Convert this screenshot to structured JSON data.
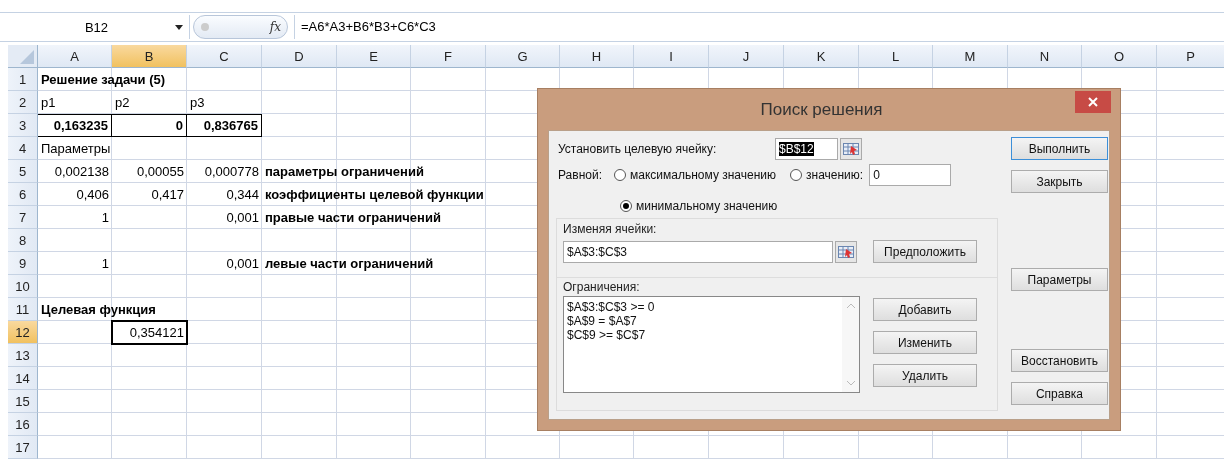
{
  "formula_bar": {
    "name_box": "B12",
    "function_symbol": "fx",
    "formula": "=A6*A3+B6*B3+C6*C3"
  },
  "sheet": {
    "columns": [
      {
        "label": "A",
        "selected": false
      },
      {
        "label": "B",
        "selected": true
      },
      {
        "label": "C",
        "selected": false
      },
      {
        "label": "D",
        "selected": false
      },
      {
        "label": "E",
        "selected": false
      },
      {
        "label": "F",
        "selected": false
      },
      {
        "label": "G",
        "selected": false
      },
      {
        "label": "H",
        "selected": false
      },
      {
        "label": "I",
        "selected": false
      },
      {
        "label": "J",
        "selected": false
      },
      {
        "label": "K",
        "selected": false
      },
      {
        "label": "L",
        "selected": false
      },
      {
        "label": "M",
        "selected": false
      },
      {
        "label": "N",
        "selected": false
      },
      {
        "label": "O",
        "selected": false
      },
      {
        "label": "P",
        "selected": false
      }
    ],
    "rows": [
      {
        "header": "1",
        "selected": false,
        "cells": [
          {
            "text": "Решение задачи (5)",
            "kind": "text",
            "bold": true,
            "bordered": false,
            "selected": false
          }
        ]
      },
      {
        "header": "2",
        "selected": false,
        "cells": [
          {
            "text": "p1",
            "kind": "text",
            "bold": false,
            "bordered": false,
            "selected": false
          },
          {
            "text": "p2",
            "kind": "text",
            "bold": false,
            "bordered": false,
            "selected": false
          },
          {
            "text": "p3",
            "kind": "text",
            "bold": false,
            "bordered": false,
            "selected": false
          }
        ]
      },
      {
        "header": "3",
        "selected": false,
        "cells": [
          {
            "text": "0,163235",
            "kind": "number",
            "bold": true,
            "bordered": true,
            "selected": false
          },
          {
            "text": "0",
            "kind": "number",
            "bold": true,
            "bordered": true,
            "selected": false
          },
          {
            "text": "0,836765",
            "kind": "number",
            "bold": true,
            "bordered": true,
            "selected": false
          }
        ]
      },
      {
        "header": "4",
        "selected": false,
        "cells": [
          {
            "text": "Параметры",
            "kind": "text",
            "bold": false,
            "bordered": false,
            "selected": false
          }
        ]
      },
      {
        "header": "5",
        "selected": false,
        "cells": [
          {
            "text": "0,002138",
            "kind": "number",
            "bold": false,
            "bordered": false,
            "selected": false
          },
          {
            "text": "0,00055",
            "kind": "number",
            "bold": false,
            "bordered": false,
            "selected": false
          },
          {
            "text": "0,000778",
            "kind": "number",
            "bold": false,
            "bordered": false,
            "selected": false
          },
          {
            "text": "параметры ограничений",
            "kind": "text",
            "bold": true,
            "bordered": false,
            "selected": false
          }
        ]
      },
      {
        "header": "6",
        "selected": false,
        "cells": [
          {
            "text": "0,406",
            "kind": "number",
            "bold": false,
            "bordered": false,
            "selected": false
          },
          {
            "text": "0,417",
            "kind": "number",
            "bold": false,
            "bordered": false,
            "selected": false
          },
          {
            "text": "0,344",
            "kind": "number",
            "bold": false,
            "bordered": false,
            "selected": false
          },
          {
            "text": "коэффициенты целевой функции",
            "kind": "text",
            "bold": true,
            "bordered": false,
            "selected": false
          }
        ]
      },
      {
        "header": "7",
        "selected": false,
        "cells": [
          {
            "text": "1",
            "kind": "number",
            "bold": false,
            "bordered": false,
            "selected": false
          },
          null,
          {
            "text": "0,001",
            "kind": "number",
            "bold": false,
            "bordered": false,
            "selected": false
          },
          {
            "text": "правые части ограничений",
            "kind": "text",
            "bold": true,
            "bordered": false,
            "selected": false
          }
        ]
      },
      {
        "header": "8",
        "selected": false,
        "cells": []
      },
      {
        "header": "9",
        "selected": false,
        "cells": [
          {
            "text": "1",
            "kind": "number",
            "bold": false,
            "bordered": false,
            "selected": false
          },
          null,
          {
            "text": "0,001",
            "kind": "number",
            "bold": false,
            "bordered": false,
            "selected": false
          },
          {
            "text": "левые части ограничений",
            "kind": "text",
            "bold": true,
            "bordered": false,
            "selected": false
          }
        ]
      },
      {
        "header": "10",
        "selected": false,
        "cells": []
      },
      {
        "header": "11",
        "selected": false,
        "cells": [
          {
            "text": "Целевая функция",
            "kind": "text",
            "bold": true,
            "bordered": false,
            "selected": false
          }
        ]
      },
      {
        "header": "12",
        "selected": true,
        "cells": [
          null,
          {
            "text": "0,354121",
            "kind": "number",
            "bold": false,
            "bordered": false,
            "selected": true
          }
        ]
      },
      {
        "header": "13",
        "selected": false,
        "cells": []
      },
      {
        "header": "14",
        "selected": false,
        "cells": []
      },
      {
        "header": "15",
        "selected": false,
        "cells": []
      },
      {
        "header": "16",
        "selected": false,
        "cells": []
      },
      {
        "header": "17",
        "selected": false,
        "cells": []
      }
    ]
  },
  "dialog": {
    "title": "Поиск решения",
    "target": {
      "label": "Установить целевую ячейку:",
      "value": "$B$12"
    },
    "equal_to": {
      "label": "Равной:",
      "options": [
        {
          "label": "максимальному значению",
          "selected": false
        },
        {
          "label": "значению:",
          "selected": false
        },
        {
          "label": "минимальному значению",
          "selected": true
        }
      ],
      "value": "0"
    },
    "changing": {
      "label": "Изменяя ячейки:",
      "value": "$A$3:$C$3",
      "guess_button": "Предположить"
    },
    "constraints": {
      "label": "Ограничения:",
      "items": [
        "$A$3:$C$3 >= 0",
        "$A$9 = $A$7",
        "$C$9 >= $C$7"
      ],
      "buttons": [
        "Добавить",
        "Изменить",
        "Удалить"
      ]
    },
    "side_buttons": [
      {
        "label": "Выполнить",
        "default": true
      },
      {
        "label": "Закрыть",
        "default": false
      },
      {
        "label": "Параметры",
        "default": false
      },
      {
        "label": "Восстановить",
        "default": false
      },
      {
        "label": "Справка",
        "default": false
      }
    ]
  }
}
